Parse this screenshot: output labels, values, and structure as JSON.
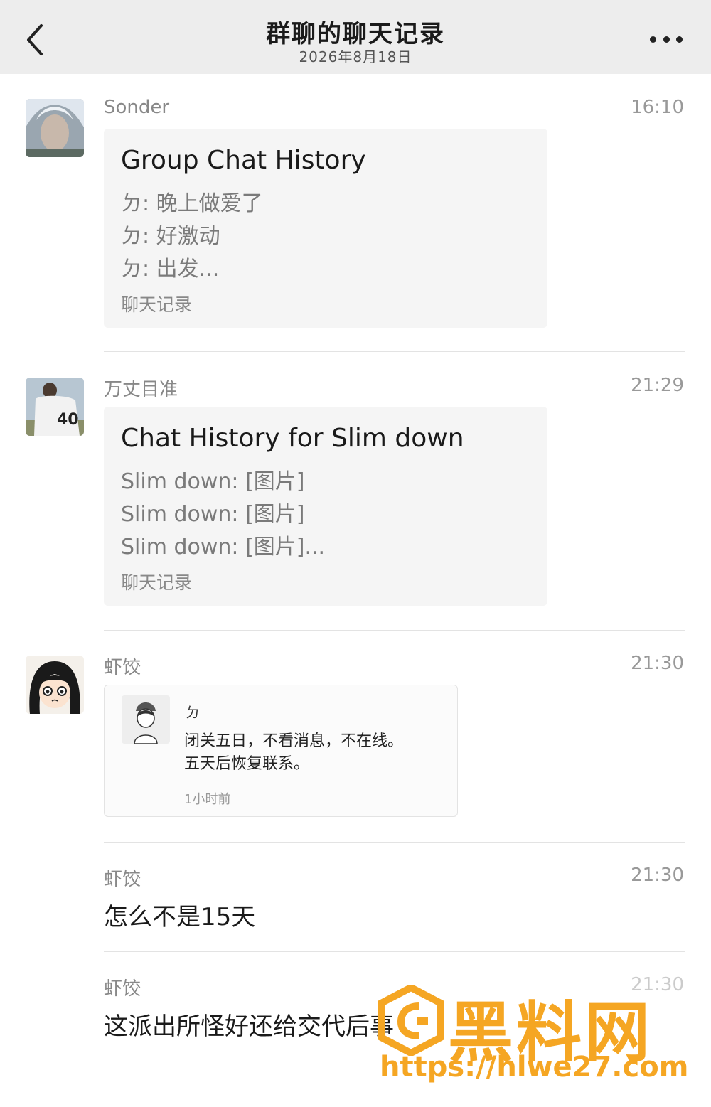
{
  "header": {
    "title": "群聊的聊天记录",
    "date": "2026年8月18日"
  },
  "messages": [
    {
      "sender": "Sonder",
      "time": "16:10",
      "card": {
        "title": "Group Chat History",
        "lines": [
          "ㄉ: 晚上做爱了",
          "ㄉ: 好激动",
          "ㄉ: 出发..."
        ],
        "footer": "聊天记录"
      }
    },
    {
      "sender": "万丈目准",
      "time": "21:29",
      "card": {
        "title": "Chat History for Slim down",
        "lines": [
          "Slim down: [图片]",
          "Slim down: [图片]",
          "Slim down: [图片]..."
        ],
        "footer": "聊天记录"
      }
    },
    {
      "sender": "虾饺",
      "time": "21:30",
      "quote": {
        "name": "ㄉ",
        "line1": "闭关五日，不看消息，不在线。",
        "line2": "五天后恢复联系。",
        "ago": "1小时前"
      }
    },
    {
      "sender": "虾饺",
      "time": "21:30",
      "text": "怎么不是15天"
    },
    {
      "sender": "虾饺",
      "time": "21:30",
      "text": "这派出所怪好还给交代后事"
    }
  ],
  "watermark": {
    "brand": "黑料网",
    "url": "https://hlwe27.com",
    "color": "#f5a623"
  },
  "icons": [
    "back-arrow-icon",
    "more-dots-icon"
  ]
}
